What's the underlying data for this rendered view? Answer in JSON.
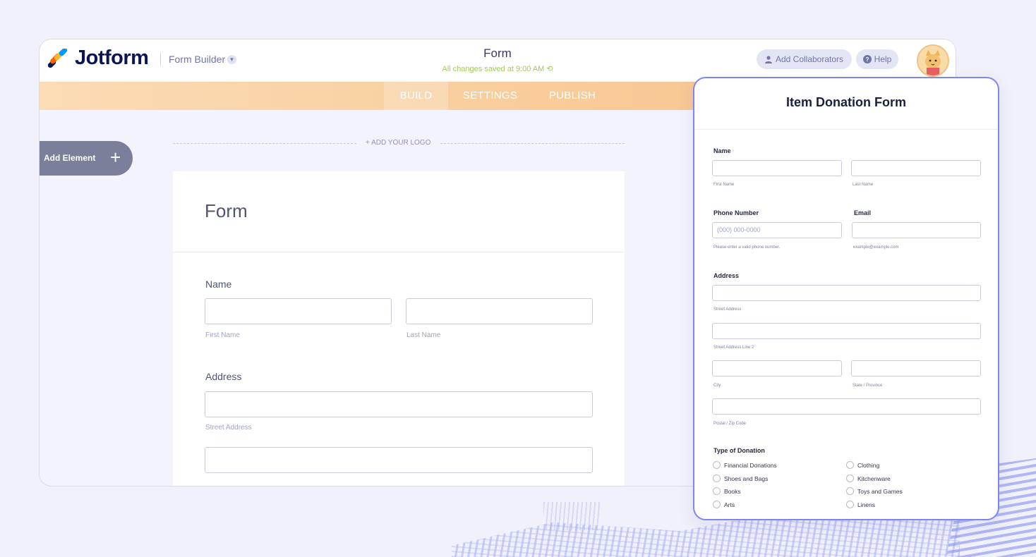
{
  "app": {
    "logo_text": "Jotform",
    "section_label": "Form Builder",
    "doc_title": "Form",
    "save_status": "All changes saved at 9:00 AM",
    "collaborators_label": "Add Collaborators",
    "help_label": "Help"
  },
  "tabs": [
    {
      "label": "BUILD",
      "active": true
    },
    {
      "label": "SETTINGS",
      "active": false
    },
    {
      "label": "PUBLISH",
      "active": false
    }
  ],
  "sidebar": {
    "add_element_label": "Add Element"
  },
  "builder_form": {
    "add_logo": "+ ADD YOUR LOGO",
    "title": "Form",
    "name_label": "Name",
    "first_name": "First Name",
    "last_name": "Last Name",
    "address_label": "Address",
    "street_address": "Street Address"
  },
  "preview": {
    "title": "Item Donation Form",
    "name_label": "Name",
    "first_name": "First Name",
    "last_name": "Last Name",
    "phone_label": "Phone Number",
    "phone_placeholder": "(000) 000-0000",
    "phone_hint": "Please enter a valid phone number.",
    "email_label": "Email",
    "email_hint": "example@example.com",
    "address_label": "Address",
    "street_address": "Street Address",
    "street_address_2": "Street Address Line 2",
    "city": "City",
    "state": "State / Province",
    "zip": "Postal / Zip Code",
    "donation_label": "Type of Donation",
    "donation_options_left": [
      "Financial Donations",
      "Shoes and Bags",
      "Books",
      "Arts"
    ],
    "donation_options_right": [
      "Clothing",
      "Kitchenware",
      "Toys and Games",
      "Linens"
    ]
  },
  "colors": {
    "brand_navy": "#0a1551",
    "nav_gradient_start": "#fbdcb6",
    "nav_gradient_end": "#f7c08a",
    "saved_green": "#9fcc5b",
    "preview_border": "#7f86f0"
  }
}
